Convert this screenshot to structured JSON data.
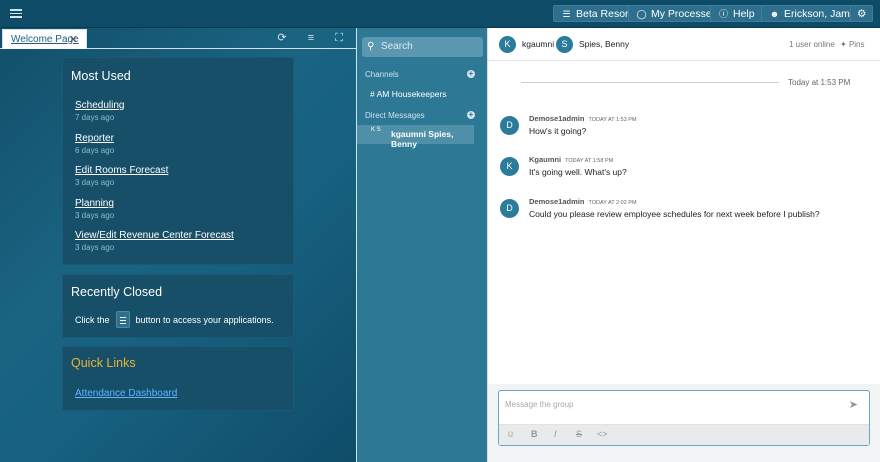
{
  "topbar": {
    "property": "Beta Resort",
    "processes": "My Processes",
    "help": "Help",
    "user": "Erickson, James"
  },
  "workspace": {
    "tab_label": "Welcome Page",
    "most_used": {
      "title": "Most Used",
      "items": [
        {
          "label": "Scheduling",
          "when": "7 days ago"
        },
        {
          "label": "Reporter",
          "when": "6 days ago"
        },
        {
          "label": "Edit Rooms Forecast",
          "when": "3 days ago"
        },
        {
          "label": "Planning",
          "when": "3 days ago"
        },
        {
          "label": "View/Edit Revenue Center Forecast",
          "when": "3 days ago"
        }
      ]
    },
    "recently_closed": {
      "title": "Recently Closed",
      "text_before": "Click the",
      "text_after": "button to access your applications."
    },
    "quick_links": {
      "title": "Quick Links",
      "link": "Attendance Dashboard"
    }
  },
  "chat_sidebar": {
    "search_placeholder": "Search",
    "channels_heading": "Channels",
    "channel": "# AM Housekeepers",
    "dm_heading": "Direct Messages",
    "dm_avatar_text": "K S",
    "dm_label": "kgaumni Spies, Benny"
  },
  "chat": {
    "header": {
      "user1_initial": "K",
      "user1_name": "kgaumni",
      "user2_initial": "S",
      "user2_name": "Spies, Benny",
      "online": "1 user online",
      "pins": "Pins"
    },
    "day_label": "Today at 1:53 PM",
    "messages": [
      {
        "initial": "D",
        "author": "Demose1admin",
        "time": "TODAY AT 1:53 PM",
        "text": "How's it going?"
      },
      {
        "initial": "K",
        "author": "Kgaumni",
        "time": "TODAY AT 1:58 PM",
        "text": "It's going well. What's up?"
      },
      {
        "initial": "D",
        "author": "Demose1admin",
        "time": "TODAY AT 2:02 PM",
        "text": "Could you please review employee schedules for next week before I publish?"
      }
    ],
    "composer_placeholder": "Message the group"
  }
}
